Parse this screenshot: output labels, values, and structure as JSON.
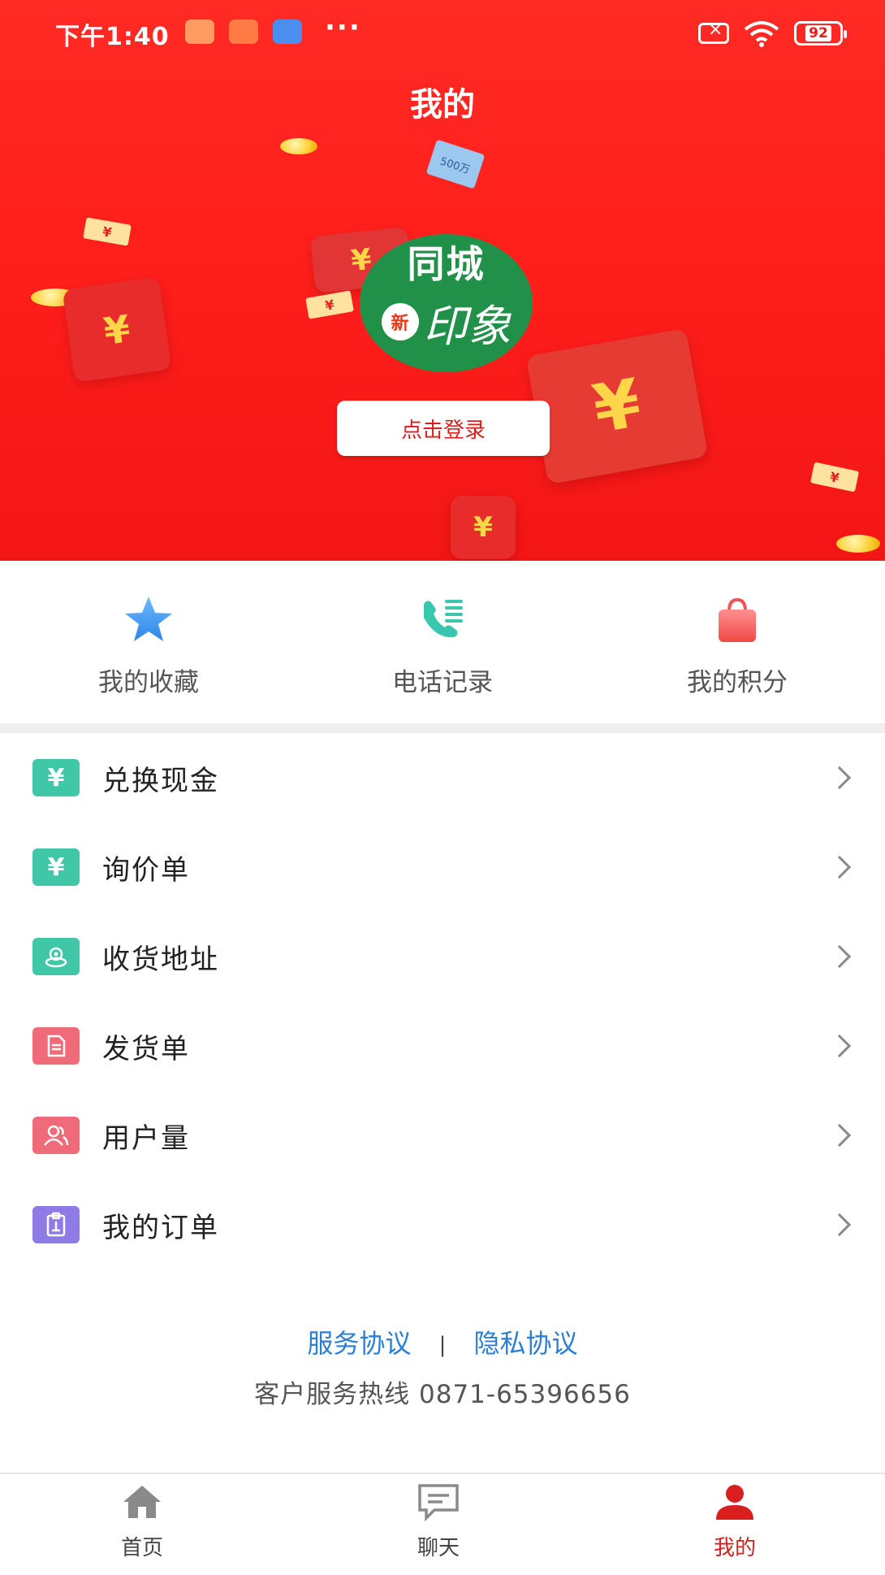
{
  "status_bar": {
    "time": "下午1:40",
    "battery": "92"
  },
  "header": {
    "title": "我的",
    "logo": {
      "line1": "同城",
      "badge": "新",
      "script": "印象"
    },
    "login_button": "点击登录",
    "decor_text": "500万"
  },
  "quick_actions": [
    {
      "label": "我的收藏",
      "icon": "star-icon"
    },
    {
      "label": "电话记录",
      "icon": "phone-log-icon"
    },
    {
      "label": "我的积分",
      "icon": "shopping-bag-icon"
    }
  ],
  "menu": [
    {
      "label": "兑换现金",
      "icon": "yen-icon",
      "icon_color": "#3fc7a8",
      "glyph": "¥"
    },
    {
      "label": "询价单",
      "icon": "yen-icon",
      "icon_color": "#3fc7a8",
      "glyph": "¥"
    },
    {
      "label": "收货地址",
      "icon": "location-icon",
      "icon_color": "#3fc7a8",
      "glyph": "◎"
    },
    {
      "label": "发货单",
      "icon": "document-icon",
      "icon_color": "#f06b7a",
      "glyph": "▤"
    },
    {
      "label": "用户量",
      "icon": "users-icon",
      "icon_color": "#f06b7a",
      "glyph": "♟"
    },
    {
      "label": "我的订单",
      "icon": "clipboard-icon",
      "icon_color": "#8e7be6",
      "glyph": "▥"
    }
  ],
  "footer": {
    "service_agreement": "服务协议",
    "separator": "|",
    "privacy_agreement": "隐私协议",
    "hotline": "客户服务热线 0871-65396656"
  },
  "bottom_nav": [
    {
      "label": "首页",
      "icon": "home-icon",
      "active": false
    },
    {
      "label": "聊天",
      "icon": "chat-icon",
      "active": false
    },
    {
      "label": "我的",
      "icon": "user-icon",
      "active": true
    }
  ],
  "colors": {
    "brand_red": "#f31616",
    "accent_red": "#d81e1e",
    "link_blue": "#2a7fd4",
    "logo_green": "#21914a"
  }
}
